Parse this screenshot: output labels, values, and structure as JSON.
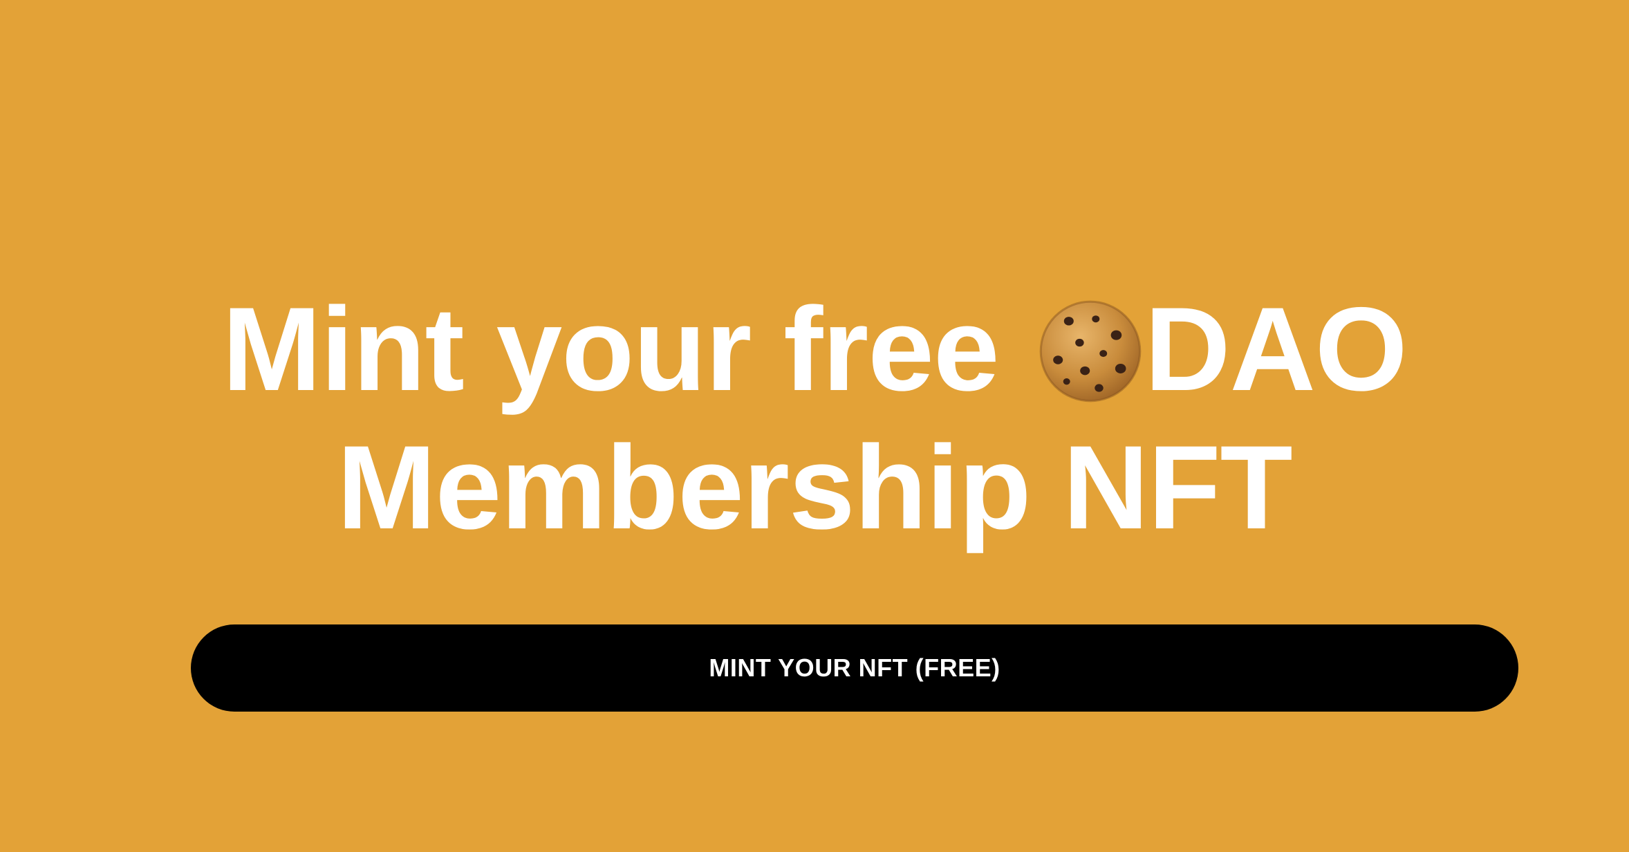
{
  "hero": {
    "headline_part1": "Mint your free",
    "headline_icon": "cookie-icon",
    "headline_part2": "DAO",
    "headline_line2": "Membership NFT"
  },
  "cta": {
    "label": "MINT YOUR NFT (FREE)"
  },
  "colors": {
    "background": "#E3A237",
    "button": "#000000",
    "text": "#FFFFFF"
  }
}
